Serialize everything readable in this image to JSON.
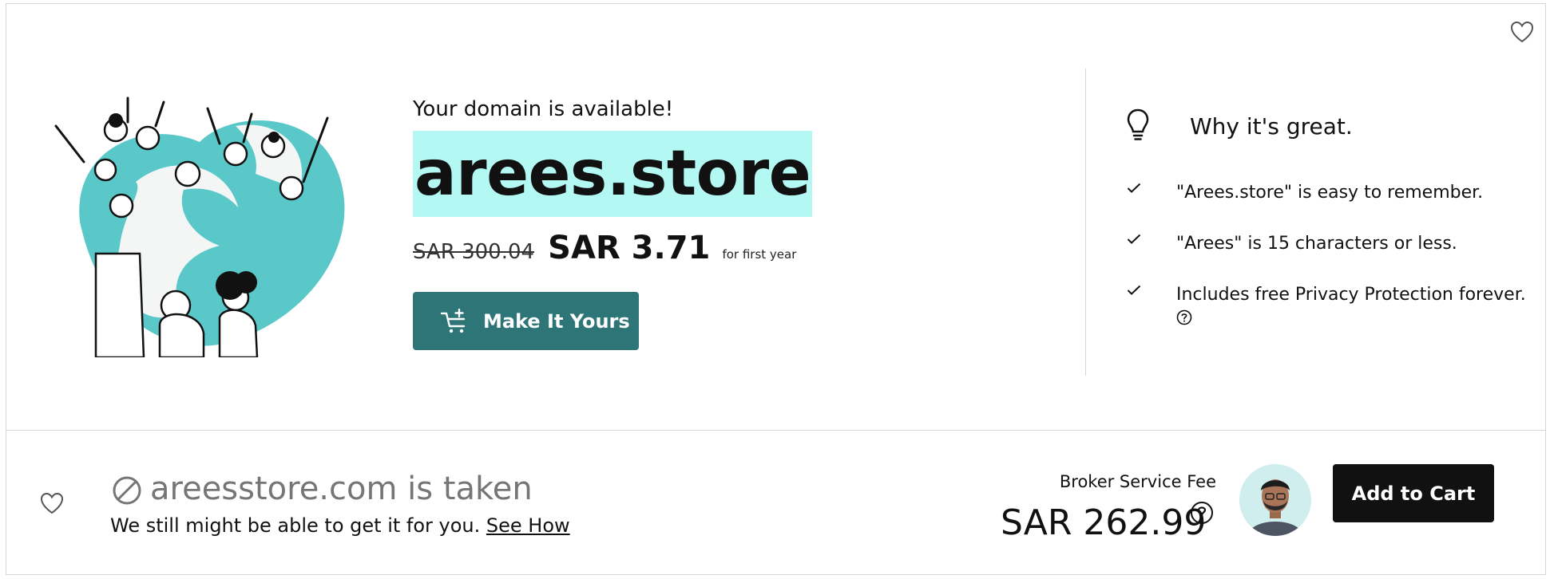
{
  "hero": {
    "heading": "Your domain is available!",
    "domain": "arees.store",
    "old_price": "SAR 300.04",
    "price": "SAR 3.71",
    "period": "for first year",
    "cta_label": "Make It Yours",
    "cta_icon": "cart-plus-icon"
  },
  "why": {
    "title": "Why it's great.",
    "icon": "lightbulb-icon",
    "reasons": [
      "\"Arees.store\" is easy to remember.",
      "\"Arees\" is 15 characters or less.",
      "Includes free Privacy Protection forever."
    ]
  },
  "taken": {
    "title": "areesstore.com is taken",
    "subtitle": "We still might be able to get it for you.",
    "link": "See How",
    "broker_label": "Broker Service Fee",
    "broker_price": "SAR 262.99",
    "cart_label": "Add to Cart"
  },
  "colors": {
    "highlight": "#b3f8f3",
    "primary_button": "#2e7577",
    "secondary_button": "#111111",
    "illustration": "#5ac7c9"
  }
}
